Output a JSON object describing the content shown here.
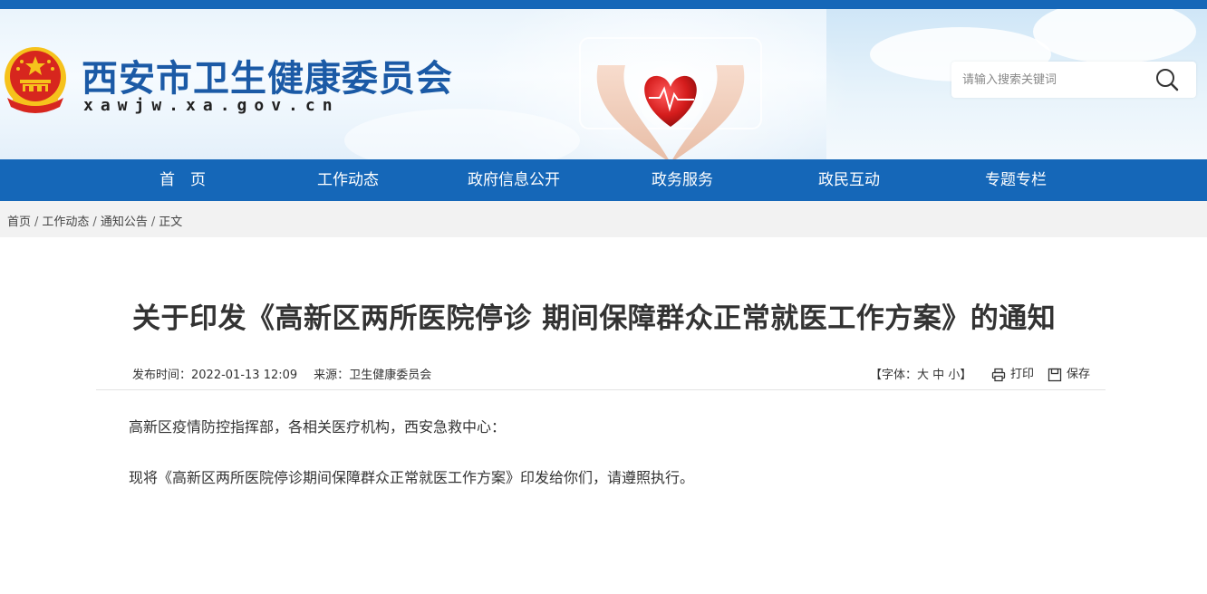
{
  "site": {
    "title": "西安市卫生健康委员会",
    "domain": "xawjw.xa.gov.cn"
  },
  "search": {
    "placeholder": "请输入搜索关键词",
    "icon": "search-icon"
  },
  "nav": {
    "items": [
      "首　页",
      "工作动态",
      "政府信息公开",
      "政务服务",
      "政民互动",
      "专题专栏"
    ]
  },
  "breadcrumb": {
    "items": [
      "首页",
      "工作动态",
      "通知公告",
      "正文"
    ],
    "separator": "/"
  },
  "article": {
    "title": "关于印发《高新区两所医院停诊 期间保障群众正常就医工作方案》的通知",
    "publish_label": "发布时间：",
    "publish_time": "2022-01-13 12:09",
    "source_label": "来源：",
    "source": "卫生健康委员会",
    "font_size_label": "【字体：",
    "font_size_options": [
      "大",
      "中",
      "小"
    ],
    "font_size_close": "】",
    "print_label": "打印",
    "save_label": "保存",
    "paragraphs": [
      "高新区疫情防控指挥部，各相关医疗机构，西安急救中心：",
      "现将《高新区两所医院停诊期间保障群众正常就医工作方案》印发给你们，请遵照执行。"
    ]
  },
  "colors": {
    "brand_blue": "#1567b8",
    "title_blue": "#1b5aa6",
    "emblem_red": "#d7261e",
    "emblem_gold": "#f6c21c"
  }
}
